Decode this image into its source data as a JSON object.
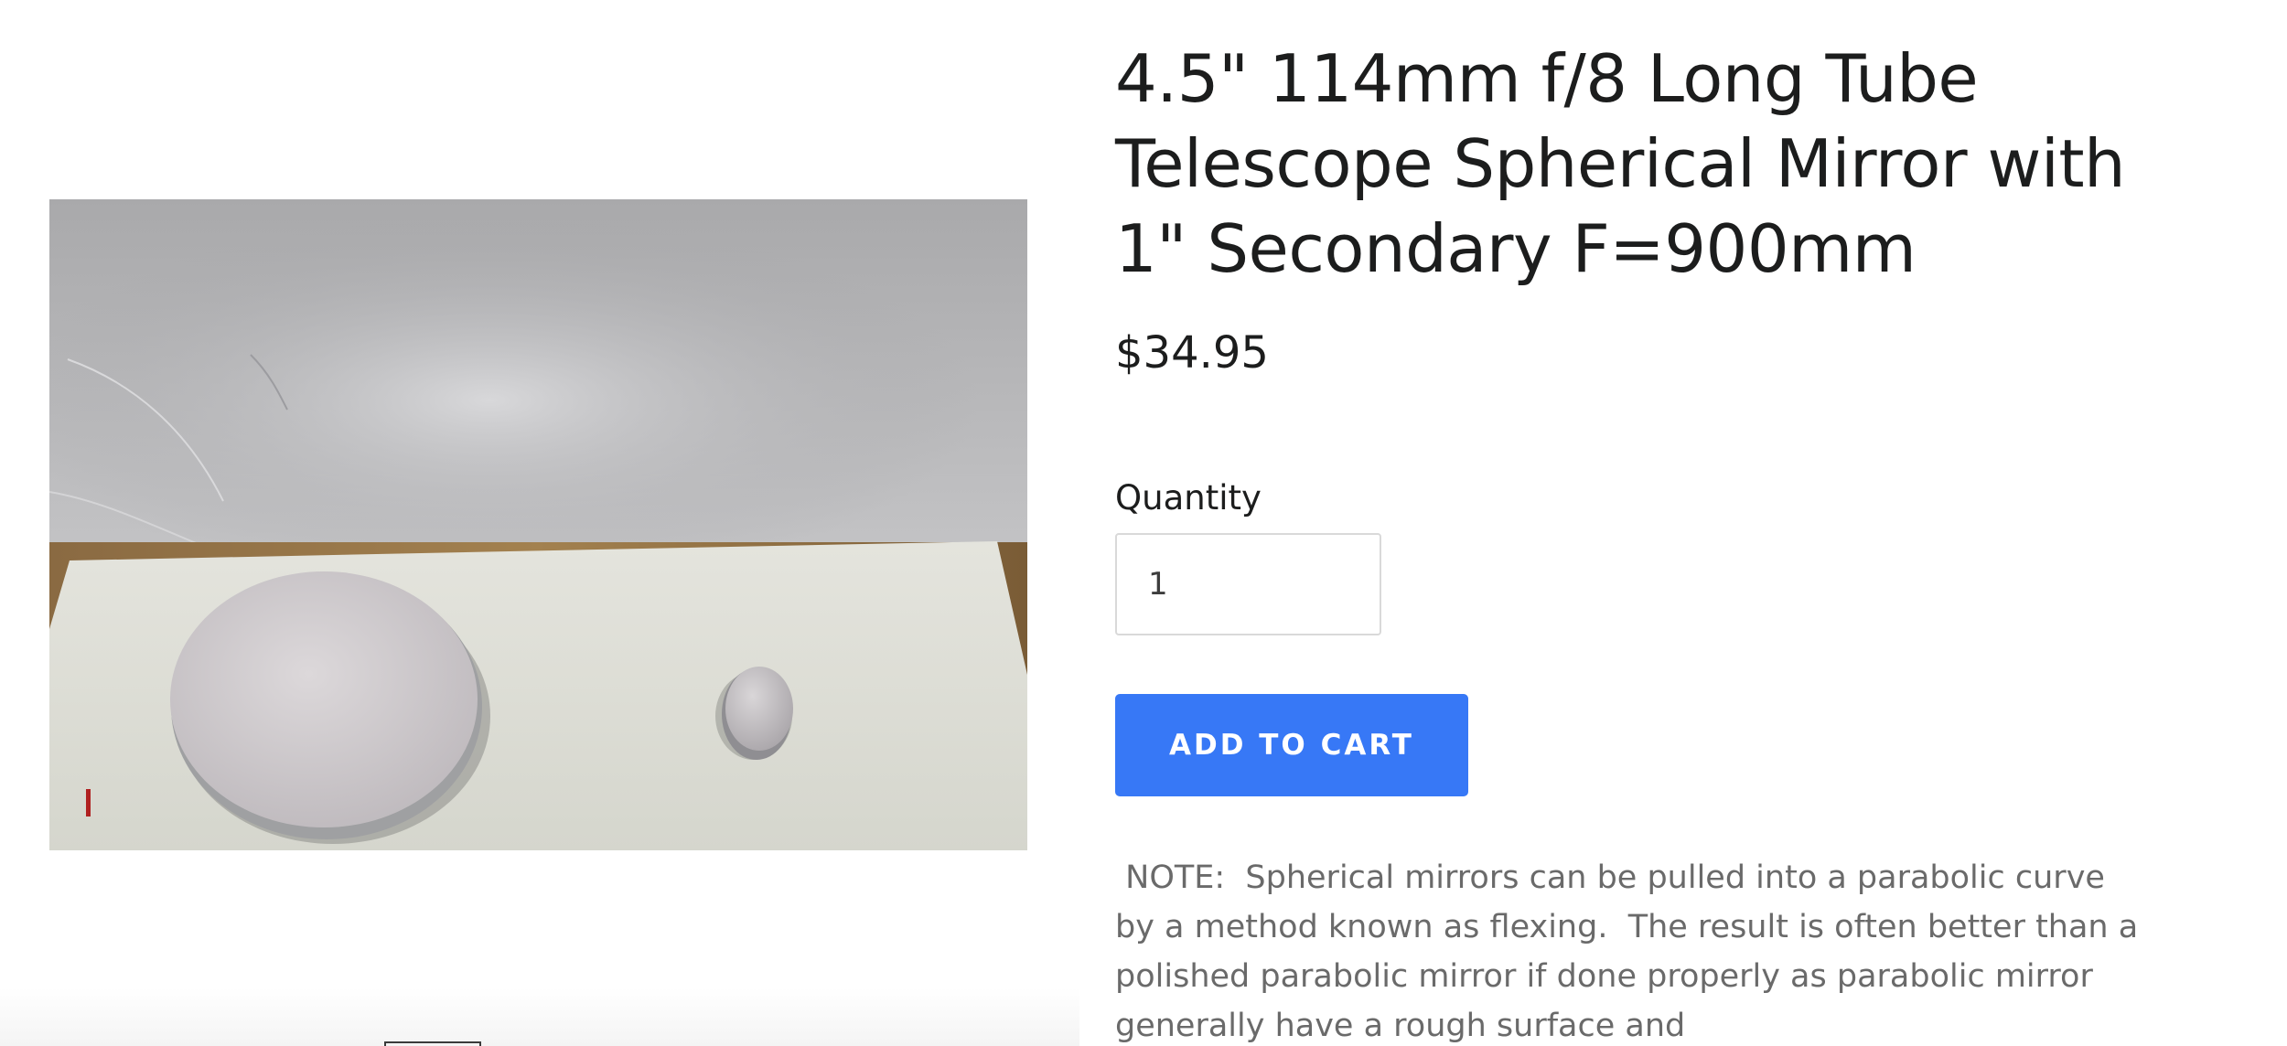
{
  "product": {
    "title": "4.5\" 114mm f/8 Long Tube Telescope Spherical Mirror with 1\" Secondary F=900mm",
    "price": "$34.95",
    "image_alt": "Primary mirror and secondary mirror on white paper"
  },
  "purchase": {
    "quantity_label": "Quantity",
    "quantity_value": "1",
    "add_to_cart_label": "ADD TO CART"
  },
  "description": {
    "text": " NOTE:  Spherical mirrors can be pulled into a parabolic curve by a method known as flexing.  The result is often better than a polished parabolic mirror if done properly as parabolic mirror generally have a rough surface and"
  },
  "colors": {
    "button": "#3778f6",
    "text": "#1c1d1d",
    "body_text": "#6a6a6a"
  }
}
